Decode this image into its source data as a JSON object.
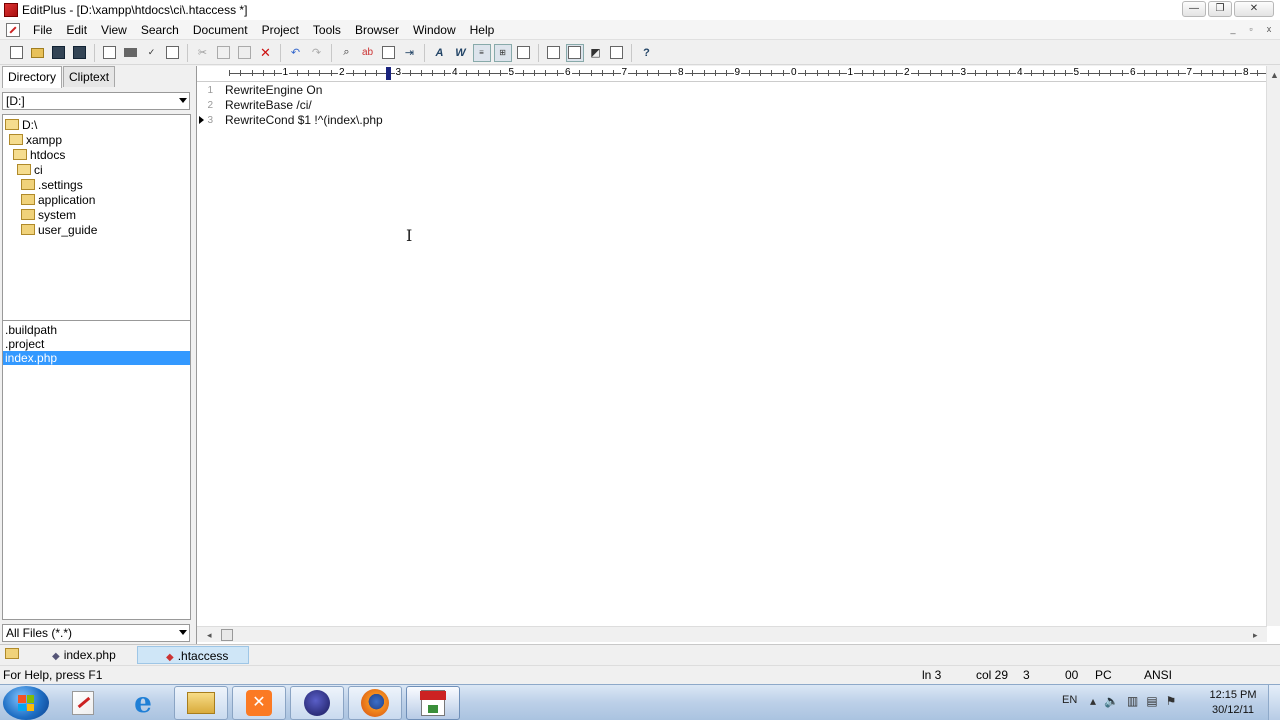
{
  "window": {
    "title": "EditPlus - [D:\\xampp\\htdocs\\ci\\.htaccess *]",
    "controls": [
      "—",
      "❐",
      "✕"
    ]
  },
  "menu": {
    "items": [
      "File",
      "Edit",
      "View",
      "Search",
      "Document",
      "Project",
      "Tools",
      "Browser",
      "Window",
      "Help"
    ],
    "mdi_controls": [
      "_",
      "▫",
      "x"
    ]
  },
  "toolbar": {
    "buttons": [
      "new-file",
      "open-file",
      "save",
      "save-all",
      "print-preview",
      "print",
      "spell-check",
      "clip",
      "cut",
      "copy",
      "paste",
      "delete",
      "undo",
      "redo",
      "find",
      "replace",
      "copy-path",
      "goto",
      "font",
      "word-wrap",
      "line-number",
      "ruler",
      "directory-window",
      "output-window",
      "cliptext",
      "browser",
      "full-screen",
      "help"
    ]
  },
  "left_panel": {
    "tabs": [
      "Directory",
      "Cliptext"
    ],
    "drive": "[D:]",
    "tree": [
      {
        "label": "D:\\",
        "level": 0,
        "open": true
      },
      {
        "label": "xampp",
        "level": 1,
        "open": true
      },
      {
        "label": "htdocs",
        "level": 2,
        "open": true
      },
      {
        "label": "ci",
        "level": 3,
        "open": true
      },
      {
        "label": ".settings",
        "level": 4,
        "open": false
      },
      {
        "label": "application",
        "level": 4,
        "open": false
      },
      {
        "label": "system",
        "level": 4,
        "open": false
      },
      {
        "label": "user_guide",
        "level": 4,
        "open": false
      }
    ],
    "files": [
      {
        "name": ".buildpath",
        "selected": false
      },
      {
        "name": ".project",
        "selected": false
      },
      {
        "name": "index.php",
        "selected": true
      }
    ],
    "filter": "All Files (*.*)"
  },
  "editor": {
    "ruler_labels": [
      "1",
      "2",
      "3",
      "4",
      "5",
      "6",
      "7",
      "8",
      "9",
      "0",
      "1",
      "2",
      "3",
      "4",
      "5",
      "6",
      "7",
      "8"
    ],
    "lines": [
      {
        "num": "1",
        "text": "RewriteEngine On",
        "current": false
      },
      {
        "num": "2",
        "text": "RewriteBase /ci/",
        "current": false
      },
      {
        "num": "3",
        "text": "RewriteCond $1 !^(index\\.php",
        "current": true
      }
    ]
  },
  "doc_tabs": [
    {
      "label": "index.php",
      "active": false
    },
    {
      "label": ".htaccess",
      "active": true
    }
  ],
  "status": {
    "help": "For Help, press F1",
    "line": "ln 3",
    "col": "col 29",
    "sel": "3",
    "code": "00",
    "mode": "PC",
    "encoding": "ANSI"
  },
  "taskbar": {
    "apps": [
      "editplus-pinned",
      "internet-explorer",
      "explorer",
      "xampp",
      "eclipse",
      "firefox",
      "editplus"
    ],
    "lang": "EN",
    "time": "12:15 PM",
    "date": "30/12/11"
  }
}
